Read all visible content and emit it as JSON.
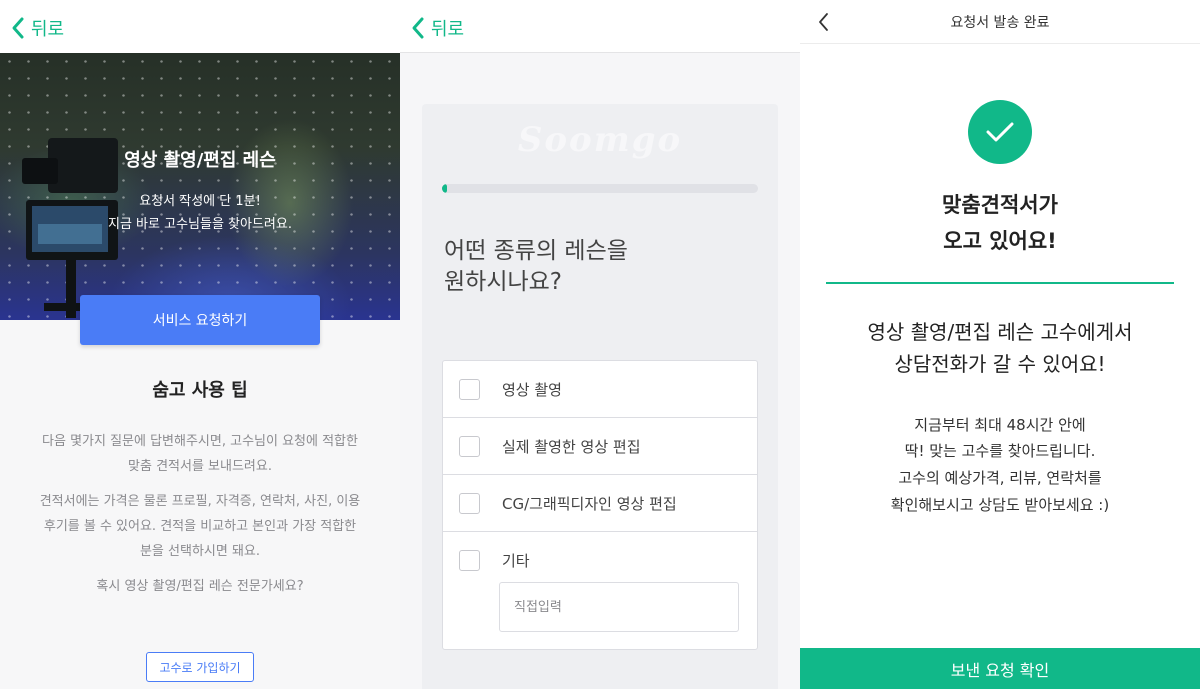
{
  "colors": {
    "accent": "#11b889",
    "primary_blue": "#4a7cf6",
    "muted_text": "#8a8a8e"
  },
  "screen1": {
    "back_label": "뒤로",
    "hero": {
      "title": "영상 촬영/편집 레슨",
      "subtitle_line1": "요청서 작성에 단 1분!",
      "subtitle_line2": "지금 바로 고수님들을 찾아드려요."
    },
    "service_request_button": "서비스 요청하기",
    "tips_title": "숨고 사용 팁",
    "tip_para1_line1": "다음 몇가지 질문에 답변해주시면, 고수님이 요청에 적합한",
    "tip_para1_line2": "맞춤 견적서를 보내드려요.",
    "tip_para2_line1": "견적서에는 가격은 물론 프로필, 자격증, 연락처, 사진, 이용",
    "tip_para2_line2": "후기를 볼 수 있어요. 견적을 비교하고 본인과 가장 적합한",
    "tip_para2_line3": "분을 선택하시면 돼요.",
    "tip_para3": "혹시 영상 촬영/편집 레슨 전문가세요?",
    "join_button": "고수로 가입하기"
  },
  "screen2": {
    "back_label": "뒤로",
    "watermark": "Soomgo",
    "progress_fraction": 0.01,
    "question_line1": "어떤 종류의 레슨을",
    "question_line2": "원하시나요?",
    "options": [
      {
        "label": "영상 촬영",
        "checked": false
      },
      {
        "label": "실제 촬영한 영상 편집",
        "checked": false
      },
      {
        "label": "CG/그래픽디자인 영상 편집",
        "checked": false
      },
      {
        "label": "기타",
        "checked": false
      }
    ],
    "direct_input_placeholder": "직접입력"
  },
  "screen3": {
    "title": "요청서 발송 완료",
    "heading_line1": "맞춤견적서가",
    "heading_line2": "오고 있어요!",
    "message_line1": "영상 촬영/편집 레슨 고수에게서",
    "message_line2": "상담전화가 갈 수 있어요!",
    "info_line1": "지금부터 최대 48시간 안에",
    "info_line2": "딱! 맞는 고수를 찾아드립니다.",
    "info_line3": "고수의 예상가격, 리뷰, 연락처를",
    "info_line4": "확인해보시고 상담도 받아보세요 :)",
    "confirm_button": "보낸 요청 확인"
  }
}
